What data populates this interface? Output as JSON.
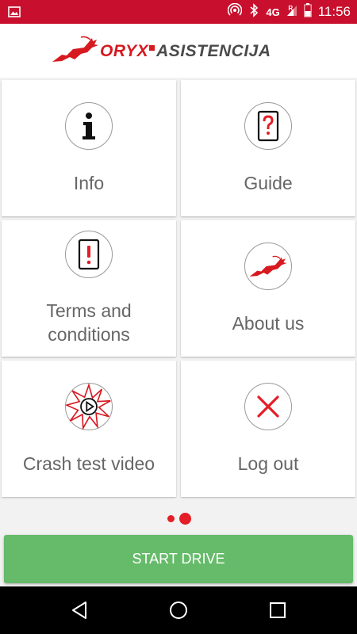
{
  "status_bar": {
    "time": "11:56",
    "network": "4G",
    "roaming": "R",
    "icons": [
      "image-icon",
      "hotspot-icon",
      "bluetooth-icon",
      "signal-icon",
      "battery-icon"
    ]
  },
  "header": {
    "logo_brand": "ORYX",
    "logo_suffix": "ASISTENCIJA"
  },
  "tiles": [
    {
      "label": "Info",
      "icon": "info-icon"
    },
    {
      "label": "Guide",
      "icon": "question-card-icon"
    },
    {
      "label_line1": "Terms and",
      "label_line2": "conditions",
      "icon": "exclamation-card-icon"
    },
    {
      "label": "About us",
      "icon": "oryx-logo-icon"
    },
    {
      "label": "Crash test video",
      "icon": "crash-video-icon"
    },
    {
      "label": "Log out",
      "icon": "close-icon"
    }
  ],
  "pager": {
    "pages": 2,
    "current": 2
  },
  "start_button": {
    "label": "START DRIVE",
    "color": "#66bb6a"
  },
  "colors": {
    "brand_red": "#c8102e",
    "accent_red": "#e41e26",
    "text_gray": "#666666"
  }
}
